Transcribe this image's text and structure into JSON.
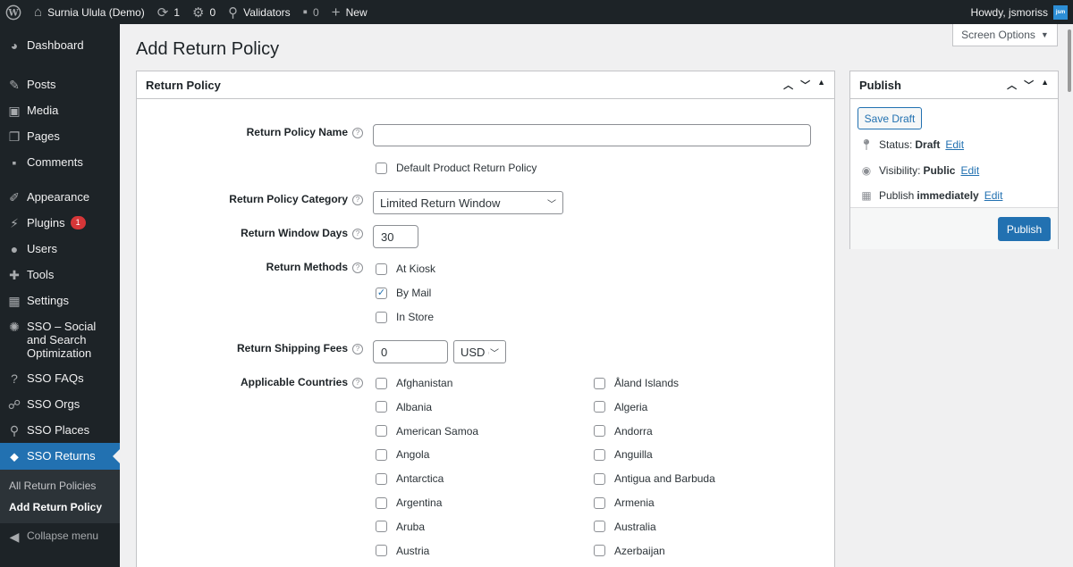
{
  "adminbar": {
    "site_name": "Surnia Ulula (Demo)",
    "updates_count": "1",
    "pending_count": "0",
    "validators": "Validators",
    "comments_count": "0",
    "new_label": "New",
    "howdy": "Howdy, jsmoriss",
    "avatar_text": "jsm"
  },
  "sidebar": {
    "items": [
      {
        "label": "Dashboard",
        "icon": "dashboard-icon"
      },
      {
        "label": "Posts",
        "icon": "pin-icon"
      },
      {
        "label": "Media",
        "icon": "media-icon"
      },
      {
        "label": "Pages",
        "icon": "pages-icon"
      },
      {
        "label": "Comments",
        "icon": "comments-icon"
      },
      {
        "label": "Appearance",
        "icon": "brush-icon"
      },
      {
        "label": "Plugins",
        "icon": "plugin-icon",
        "badge": "1"
      },
      {
        "label": "Users",
        "icon": "users-icon"
      },
      {
        "label": "Tools",
        "icon": "wrench-icon"
      },
      {
        "label": "Settings",
        "icon": "settings-icon"
      },
      {
        "label": "SSO – Social and Search Optimization",
        "icon": "sso-icon"
      },
      {
        "label": "SSO FAQs",
        "icon": "question-icon"
      },
      {
        "label": "SSO Orgs",
        "icon": "groups-icon"
      },
      {
        "label": "SSO Places",
        "icon": "location-icon"
      },
      {
        "label": "SSO Returns",
        "icon": "tag-icon"
      }
    ],
    "submenu": [
      "All Return Policies",
      "Add Return Policy"
    ],
    "collapse": "Collapse menu"
  },
  "screen_options": "Screen Options",
  "page_title": "Add Return Policy",
  "return_policy_box": {
    "title": "Return Policy",
    "name_label": "Return Policy Name",
    "name_value": "",
    "default_label": "Default Product Return Policy",
    "category_label": "Return Policy Category",
    "category_value": "Limited Return Window",
    "window_label": "Return Window Days",
    "window_value": "30",
    "methods_label": "Return Methods",
    "methods": [
      {
        "label": "At Kiosk",
        "checked": false
      },
      {
        "label": "By Mail",
        "checked": true
      },
      {
        "label": "In Store",
        "checked": false
      }
    ],
    "fees_label": "Return Shipping Fees",
    "fees_value": "0",
    "currency_value": "USD (",
    "countries_label": "Applicable Countries",
    "countries_left": [
      "Afghanistan",
      "Albania",
      "American Samoa",
      "Angola",
      "Antarctica",
      "Argentina",
      "Aruba",
      "Austria"
    ],
    "countries_right": [
      "Åland Islands",
      "Algeria",
      "Andorra",
      "Anguilla",
      "Antigua and Barbuda",
      "Armenia",
      "Australia",
      "Azerbaijan"
    ]
  },
  "publish_box": {
    "title": "Publish",
    "save_draft": "Save Draft",
    "status_label": "Status:",
    "status_value": "Draft",
    "visibility_label": "Visibility:",
    "visibility_value": "Public",
    "publish_label": "Publish",
    "publish_value": "immediately",
    "edit": "Edit",
    "publish_button": "Publish"
  },
  "colors": {
    "accent": "#2271b1",
    "adminbar": "#1d2327",
    "badge": "#d63638"
  }
}
